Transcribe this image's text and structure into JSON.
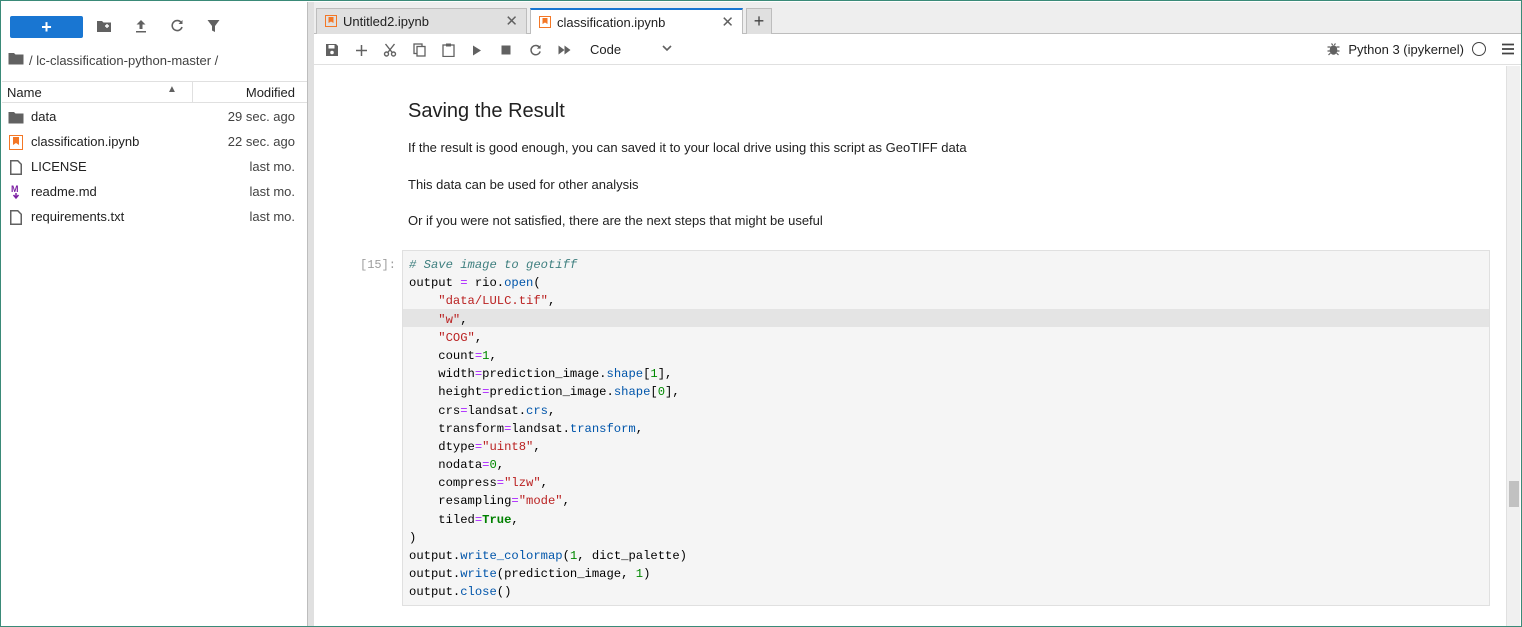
{
  "file_browser": {
    "new_button_label": "+",
    "breadcrumb": "/ lc-classification-python-master /",
    "columns": {
      "name": "Name",
      "modified": "Modified"
    },
    "files": [
      {
        "name": "data",
        "modified": "29 sec. ago",
        "icon": "folder-icon"
      },
      {
        "name": "classification.ipynb",
        "modified": "22 sec. ago",
        "icon": "notebook-icon"
      },
      {
        "name": "LICENSE",
        "modified": "last mo.",
        "icon": "file-icon"
      },
      {
        "name": "readme.md",
        "modified": "last mo.",
        "icon": "markdown-icon"
      },
      {
        "name": "requirements.txt",
        "modified": "last mo.",
        "icon": "file-icon"
      }
    ]
  },
  "tabs": [
    {
      "label": "Untitled2.ipynb",
      "close": "✕",
      "active": false
    },
    {
      "label": "classification.ipynb",
      "close": "✕",
      "active": true
    }
  ],
  "tab_add_label": "+",
  "notebook_toolbar": {
    "cell_type": "Code",
    "kernel_name": "Python 3 (ipykernel)"
  },
  "markdown": {
    "heading": "Saving the Result",
    "paragraphs": [
      "If the result is good enough, you can saved it to your local drive using this script as GeoTIFF data",
      "This data can be used for other analysis",
      "Or if you were not satisfied, there are the next steps that might be useful"
    ]
  },
  "code_cell": {
    "prompt": "[15]:",
    "lines": [
      "# Save image to geotiff",
      "output = rio.open(",
      "    \"data/LULC.tif\",",
      "    \"w\",",
      "    \"COG\",",
      "    count=1,",
      "    width=prediction_image.shape[1],",
      "    height=prediction_image.shape[0],",
      "    crs=landsat.crs,",
      "    transform=landsat.transform,",
      "    dtype=\"uint8\",",
      "    nodata=0,",
      "    compress=\"lzw\",",
      "    resampling=\"mode\",",
      "    tiled=True,",
      ")",
      "output.write_colormap(1, dict_palette)",
      "output.write(prediction_image, 1)",
      "output.close()"
    ]
  },
  "colors": {
    "accent": "#1976d2",
    "notebook_icon": "#f37726",
    "markdown_icon": "#7b1fa2"
  }
}
